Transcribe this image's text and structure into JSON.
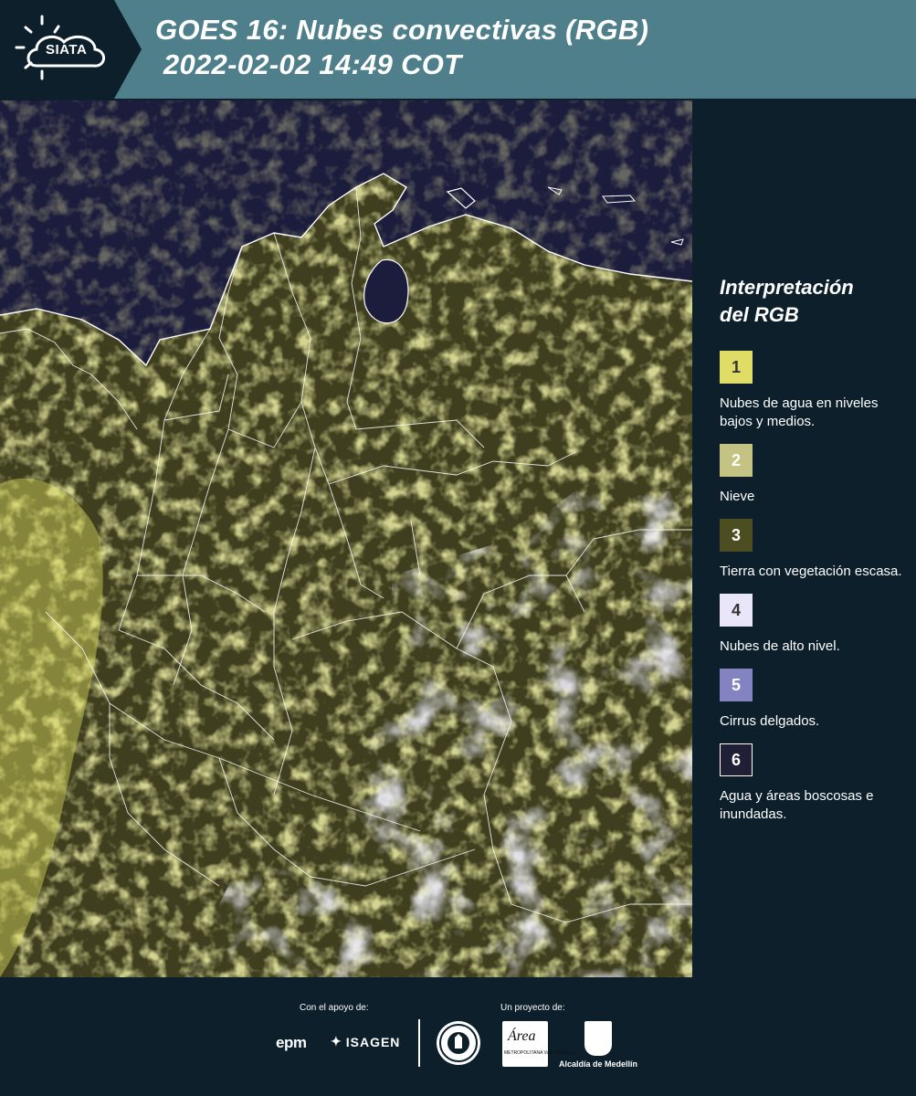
{
  "header": {
    "logo_text": "SIATA",
    "title_line1": "GOES 16: Nubes convectivas (RGB)",
    "title_line2": " 2022-02-02 14:49 COT"
  },
  "legend": {
    "title_line1": "Interpretación",
    "title_line2": "del RGB",
    "items": [
      {
        "number": "1",
        "color": "#dfdd66",
        "text_color": "#333333",
        "description": "Nubes de agua en niveles bajos y medios."
      },
      {
        "number": "2",
        "color": "#c4c383",
        "text_color": "#ffffff",
        "description": "Nieve"
      },
      {
        "number": "3",
        "color": "#4d4d22",
        "text_color": "#ffffff",
        "description": "Tierra con vegetación escasa."
      },
      {
        "number": "4",
        "color": "#e8e6f8",
        "text_color": "#333333",
        "description": "Nubes de alto nivel."
      },
      {
        "number": "5",
        "color": "#8383c2",
        "text_color": "#ffffff",
        "description": "Cirrus delgados."
      },
      {
        "number": "6",
        "color": "#1f2035",
        "text_color": "#ffffff",
        "description": "Agua y áreas boscosas e inundadas."
      }
    ]
  },
  "map": {
    "colors": {
      "ocean": "#1c1d3c",
      "land_low_cloud": "#3f3f1f",
      "cloud_yellow": "#dcdb5e",
      "cloud_high": "#d9d8f2",
      "border": "#ffffff"
    }
  },
  "footer": {
    "support_label": "Con el apoyo de:",
    "project_label": "Un proyecto de:",
    "sponsor_epm": "epm",
    "sponsor_isagen": "ISAGEN",
    "area_logo_word": "Área",
    "area_logo_sub": "METROPOLITANA Valle de Aburrá",
    "alcaldia": "Alcaldía de Medellín"
  }
}
